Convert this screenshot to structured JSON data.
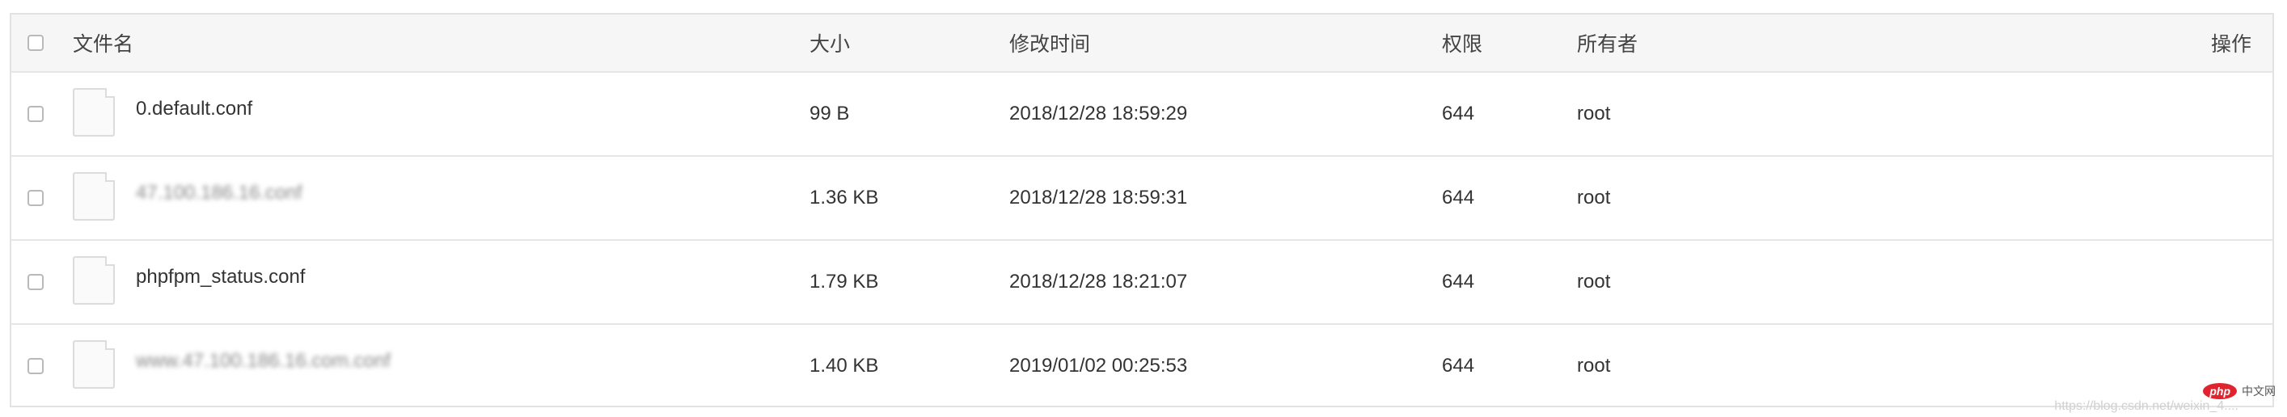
{
  "table": {
    "headers": {
      "name": "文件名",
      "size": "大小",
      "modified": "修改时间",
      "permission": "权限",
      "owner": "所有者",
      "actions": "操作"
    },
    "rows": [
      {
        "name": "0.default.conf",
        "size": "99 B",
        "modified": "2018/12/28 18:59:29",
        "permission": "644",
        "owner": "root",
        "blurred": false
      },
      {
        "name": "47.100.186.16.conf",
        "size": "1.36 KB",
        "modified": "2018/12/28 18:59:31",
        "permission": "644",
        "owner": "root",
        "blurred": true
      },
      {
        "name": "phpfpm_status.conf",
        "size": "1.79 KB",
        "modified": "2018/12/28 18:21:07",
        "permission": "644",
        "owner": "root",
        "blurred": false
      },
      {
        "name": "www.47.100.186.16.com.conf",
        "size": "1.40 KB",
        "modified": "2019/01/02 00:25:53",
        "permission": "644",
        "owner": "root",
        "blurred": true
      }
    ]
  },
  "watermark": "https://blog.csdn.net/weixin_4....",
  "brand": {
    "logo": "php",
    "text": "中文网"
  }
}
